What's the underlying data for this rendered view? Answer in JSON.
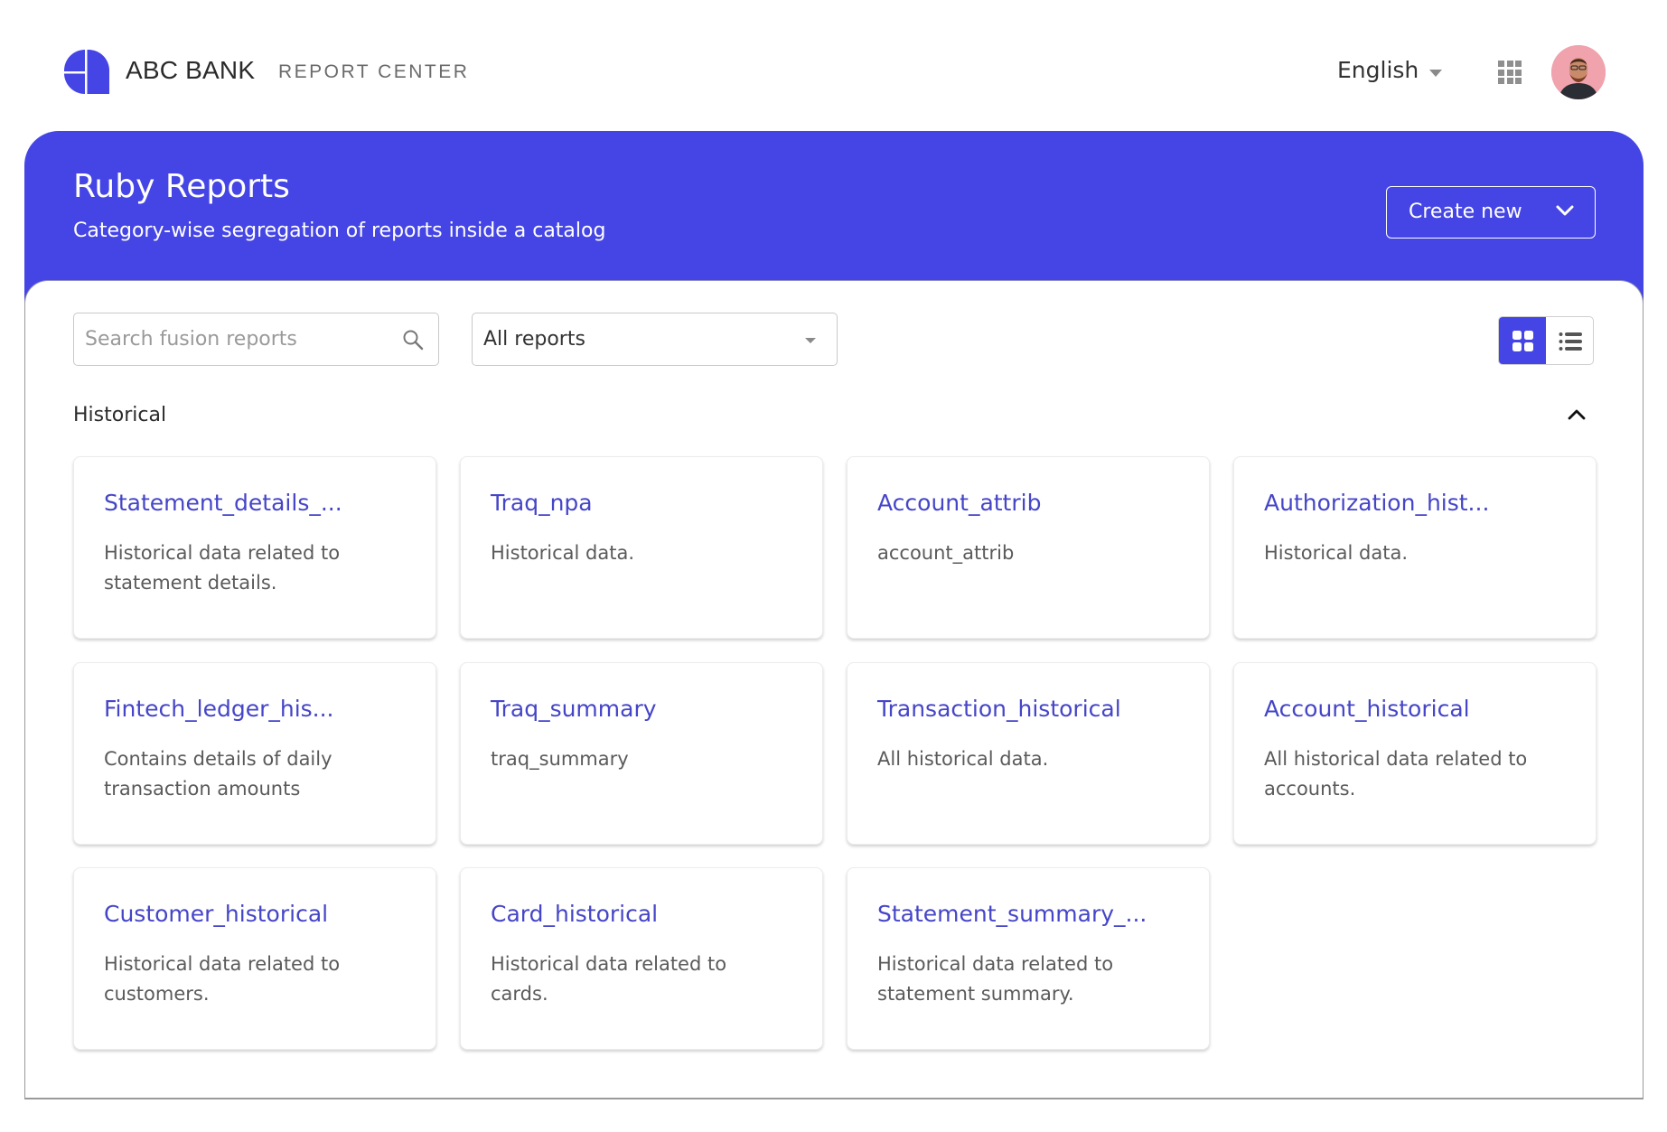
{
  "header": {
    "brand": "ABC BANK",
    "product": "REPORT CENTER",
    "language": "English",
    "icons": {
      "logo": "abc-bank-logo",
      "apps": "apps-grid-icon",
      "avatar": "user-avatar"
    }
  },
  "banner": {
    "title": "Ruby Reports",
    "subtitle": "Category-wise segregation of reports inside a catalog",
    "create_button": "Create new",
    "accent": "#4545e5"
  },
  "filters": {
    "search_placeholder": "Search fusion reports",
    "search_value": "",
    "report_filter": "All reports",
    "view_mode": "grid"
  },
  "section": {
    "label": "Historical",
    "expanded": true,
    "cards": [
      {
        "name": "Statement_details_...",
        "desc": "Historical data related to statement details."
      },
      {
        "name": "Traq_npa",
        "desc": "Historical data."
      },
      {
        "name": "Account_attrib",
        "desc": "account_attrib"
      },
      {
        "name": "Authorization_hist...",
        "desc": "Historical data."
      },
      {
        "name": "Fintech_ledger_his...",
        "desc": "Contains details of daily transaction amounts"
      },
      {
        "name": "Traq_summary",
        "desc": "traq_summary"
      },
      {
        "name": "Transaction_historical",
        "desc": "All historical data."
      },
      {
        "name": "Account_historical",
        "desc": "All historical data related to accounts."
      },
      {
        "name": "Customer_historical",
        "desc": "Historical data related to customers."
      },
      {
        "name": "Card_historical",
        "desc": "Historical data related to cards."
      },
      {
        "name": "Statement_summary_...",
        "desc": "Historical data related to statement summary."
      }
    ]
  }
}
